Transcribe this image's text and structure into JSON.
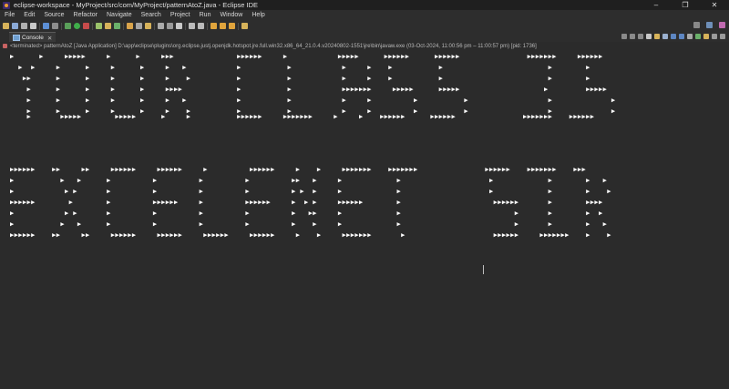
{
  "window": {
    "title": "eclipse-workspace - MyProject/src/com/MyProject/patternAtoZ.java - Eclipse IDE",
    "controls": [
      "–",
      "❐",
      "✕"
    ]
  },
  "menu": [
    "File",
    "Edit",
    "Source",
    "Refactor",
    "Navigate",
    "Search",
    "Project",
    "Run",
    "Window",
    "Help"
  ],
  "views": {
    "console_label": "Console",
    "close_glyph": "✕"
  },
  "console": {
    "header": "<terminated> patternAtoZ [Java Application] D:\\app\\eclipse\\plugins\\org.eclipse.justj.openjdk.hotspot.jre.full.win32.x86_64_21.0.4.v20240802-1551\\jre\\bin\\javaw.exe  (03-Oct-2024, 11:00:56 pm – 11:00:57 pm) [pid: 1736]",
    "output": [
      "▶      ▶     ▶▶▶▶▶     ▶      ▶     ▶▶▶               ▶▶▶▶▶▶     ▶            ▶▶▶▶▶      ▶▶▶▶▶▶      ▶▶▶▶▶▶                ▶▶▶▶▶▶▶     ▶▶▶▶▶▶",
      "  ▶  ▶     ▶      ▶     ▶      ▶     ▶   ▶            ▶           ▶            ▶     ▶    ▶           ▶                         ▶        ▶",
      "   ▶▶      ▶      ▶     ▶      ▶     ▶    ▶           ▶           ▶            ▶     ▶    ▶           ▶                         ▶        ▶",
      "    ▶      ▶      ▶     ▶      ▶     ▶▶▶▶             ▶           ▶            ▶▶▶▶▶▶▶     ▶▶▶▶▶      ▶▶▶▶▶                    ▶         ▶▶▶▶▶",
      "    ▶      ▶      ▶     ▶      ▶     ▶   ▶            ▶           ▶            ▶     ▶          ▶           ▶                   ▶              ▶",
      "    ▶      ▶      ▶     ▶      ▶     ▶    ▶           ▶           ▶            ▶     ▶          ▶           ▶                   ▶              ▶",
      "    ▶       ▶▶▶▶▶        ▶▶▶▶▶      ▶     ▶           ▶▶▶▶▶▶     ▶▶▶▶▶▶▶     ▶     ▶    ▶▶▶▶▶▶      ▶▶▶▶▶▶                ▶▶▶▶▶▶▶    ▶▶▶▶▶▶",
      "",
      "",
      "",
      "",
      "",
      "",
      "▶▶▶▶▶▶    ▶▶     ▶▶     ▶▶▶▶▶▶     ▶▶▶▶▶▶     ▶          ▶▶▶▶▶▶     ▶    ▶     ▶▶▶▶▶▶▶    ▶▶▶▶▶▶▶                ▶▶▶▶▶▶    ▶▶▶▶▶▶▶    ▶▶▶",
      "▶           ▶   ▶      ▶          ▶          ▶          ▶          ▶▶   ▶     ▶             ▶                     ▶             ▶        ▶   ▶",
      "▶            ▶ ▶       ▶          ▶          ▶          ▶          ▶ ▶  ▶     ▶             ▶                     ▶             ▶        ▶    ▶",
      "▶▶▶▶▶▶        ▶        ▶          ▶▶▶▶▶▶     ▶          ▶▶▶▶▶▶     ▶  ▶ ▶     ▶▶▶▶▶▶        ▶                      ▶▶▶▶▶▶       ▶        ▶▶▶▶",
      "▶            ▶ ▶       ▶          ▶          ▶          ▶          ▶   ▶▶     ▶             ▶                           ▶       ▶        ▶  ▶",
      "▶           ▶   ▶      ▶          ▶          ▶          ▶          ▶    ▶     ▶             ▶                           ▶       ▶        ▶   ▶",
      "▶▶▶▶▶▶    ▶▶     ▶▶     ▶▶▶▶▶▶     ▶▶▶▶▶▶     ▶▶▶▶▶▶     ▶▶▶▶▶▶     ▶    ▶     ▶▶▶▶▶▶▶       ▶                     ▶▶▶▶▶▶     ▶▶▶▶▶▶▶    ▶    ▶"
    ]
  },
  "colors": {
    "background": "#2b2b2b",
    "titlebar": "#1f1f1f",
    "text": "#ffffff",
    "terminated_icon": "#c86363"
  }
}
